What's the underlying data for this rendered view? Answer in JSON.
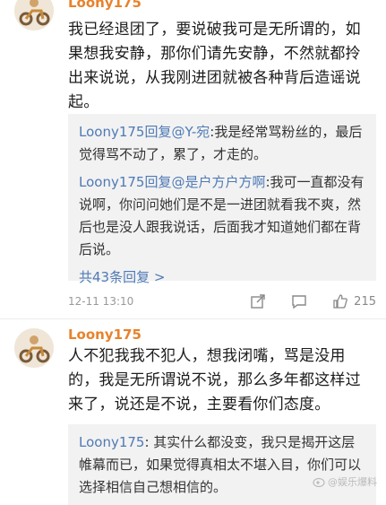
{
  "comments": [
    {
      "user": "Loony175",
      "text": "我已经退团了，要说破我可是无所谓的，如果想我安静，那你们请先安静，不然就都拎出来说说，从我刚进团就被各种背后造谣说起。",
      "replies": [
        {
          "name": "Loony175",
          "prefix": "回复",
          "target": "@Y-宛",
          "text": ":我是经常骂粉丝的，最后觉得骂不动了，累了，才走的。"
        },
        {
          "name": "Loony175",
          "prefix": "回复",
          "target": "@是户方户方啊",
          "text": ":我可一直都没有说啊，你问问她们是不是一进团就看我不爽，然后也是没人跟我说话，后面我才知道她们都在背后说。"
        }
      ],
      "more_replies": "共43条回复 >",
      "time": "12-11 13:10",
      "likes": "215"
    },
    {
      "user": "Loony175",
      "text": "人不犯我我不犯人，想我闭嘴，骂是没用的，我是无所谓说不说，那么多年都这样过来了，说还是不说，主要看你们态度。",
      "replies": [
        {
          "name": "Loony175",
          "prefix": "",
          "target": "",
          "text": ": 其实什么都没变，我只是揭开这层帷幕而已，如果觉得真相太不堪入目，你们可以选择相信自己想相信的。"
        }
      ]
    }
  ],
  "watermark": "@娱乐爆料"
}
